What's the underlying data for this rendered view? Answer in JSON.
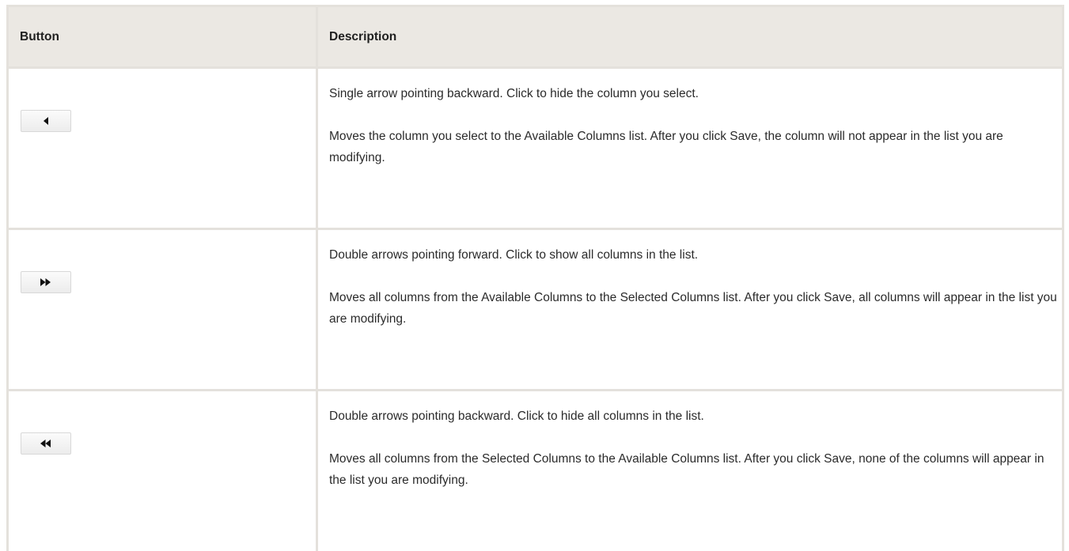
{
  "table": {
    "headers": {
      "button": "Button",
      "description": "Description"
    },
    "rows": [
      {
        "icon": "single-arrow-backward-icon",
        "summary": "Single arrow pointing backward. Click to hide the column you select.",
        "detail": "Moves the column you select to the Available Columns list. After you click Save, the column will not appear in the list you are modifying."
      },
      {
        "icon": "double-arrow-forward-icon",
        "summary": "Double arrows pointing forward. Click to show all columns in the list.",
        "detail": "Moves all columns from the Available Columns to the Selected Columns list. After you click Save, all columns will appear in the list you are modifying."
      },
      {
        "icon": "double-arrow-backward-icon",
        "summary": "Double arrows pointing backward. Click to hide all columns in the list.",
        "detail": "Moves all columns from the Selected Columns to the Available Columns list. After you click Save, none of the columns will appear in the list you are modifying."
      }
    ]
  },
  "colors": {
    "header_background": "#ebe8e3",
    "border": "#e4e1dc",
    "text": "#2b2b2b"
  }
}
